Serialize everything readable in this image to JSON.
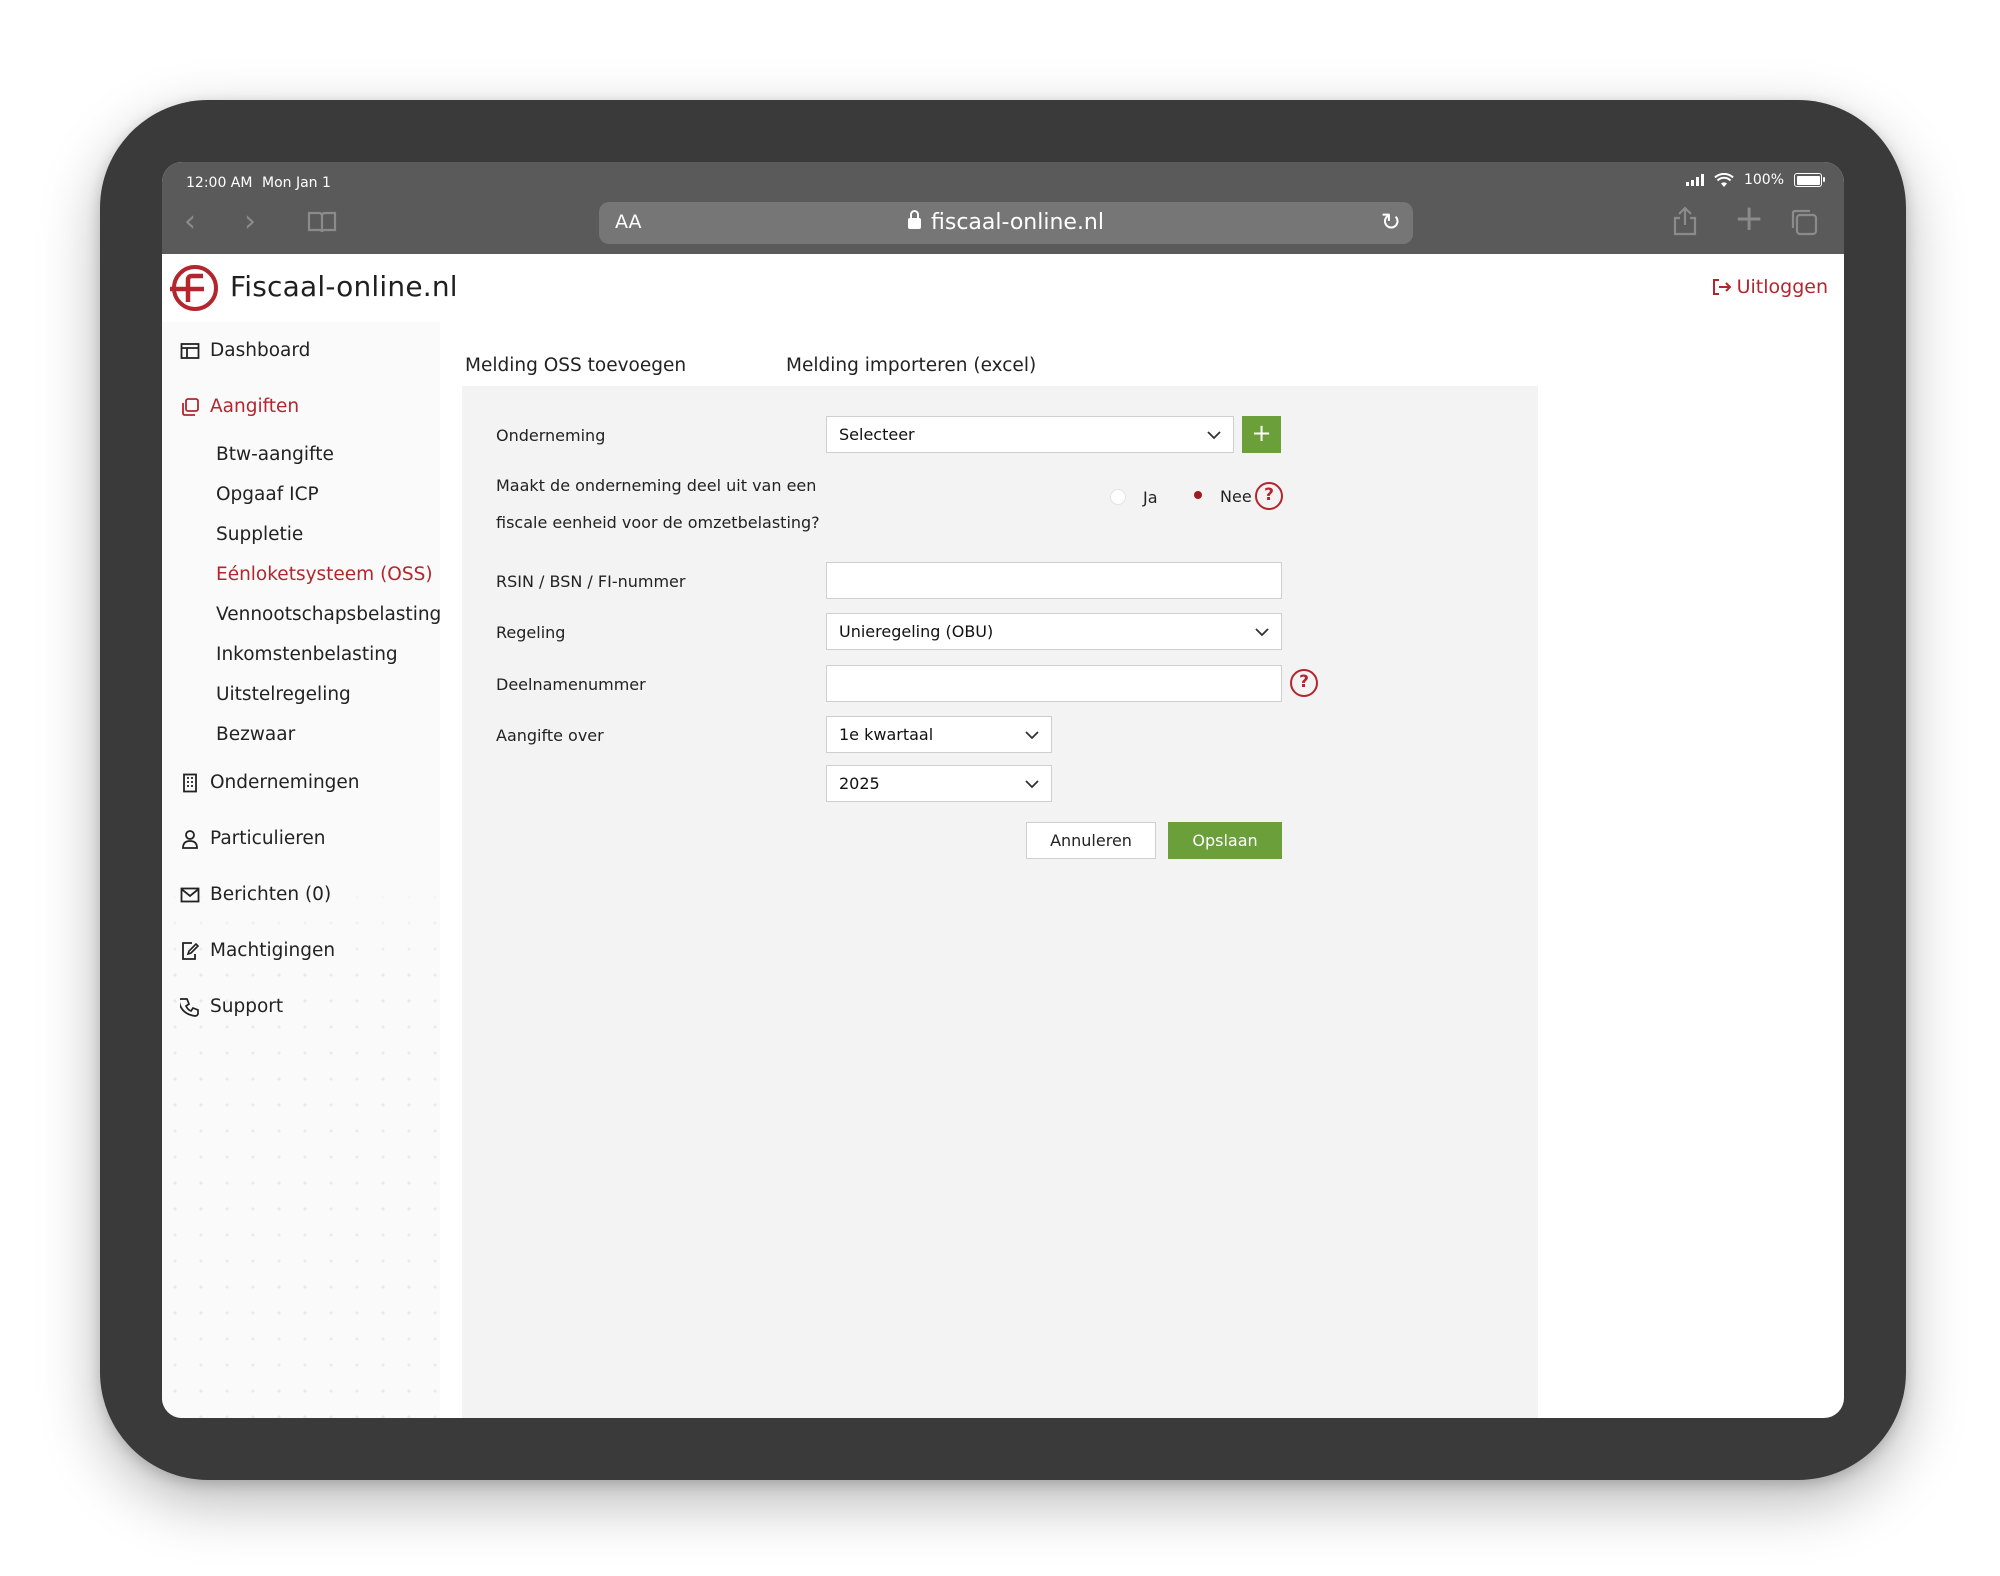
{
  "status_bar": {
    "time": "12:00 AM",
    "date": "Mon Jan 1",
    "battery": "100%"
  },
  "browser": {
    "text_size": "AA",
    "url": "fiscaal-online.nl"
  },
  "brand": {
    "name": "Fiscaal-online.nl",
    "color": "#b3262d"
  },
  "header": {
    "logout_label": "Uitloggen"
  },
  "sidebar": {
    "dashboard": "Dashboard",
    "aangiften": "Aangiften",
    "sub_items": [
      "Btw-aangifte",
      "Opgaaf ICP",
      "Suppletie",
      "Eénloketsysteem (OSS)",
      "Vennootschapsbelasting",
      "Inkomstenbelasting",
      "Uitstelregeling",
      "Bezwaar"
    ],
    "ondernemingen": "Ondernemingen",
    "particulieren": "Particulieren",
    "berichten": "Berichten (0)",
    "machtigingen": "Machtigingen",
    "support": "Support"
  },
  "tabs": [
    "Melding OSS toevoegen",
    "Melding importeren (excel)"
  ],
  "form": {
    "onderneming_label": "Onderneming",
    "onderneming_value": "Selecteer",
    "fiscale_question_line1": "Maakt de onderneming deel uit van een",
    "fiscale_question_line2": "fiscale eenheid voor de omzetbelasting?",
    "radio_ja": "Ja",
    "radio_nee": "Nee",
    "radio_selected": "Nee",
    "rsin_label": "RSIN / BSN / FI-nummer",
    "rsin_value": "",
    "regeling_label": "Regeling",
    "regeling_value": "Unieregeling (OBU)",
    "deelname_label": "Deelnamenummer",
    "deelname_value": "",
    "aangifte_label": "Aangifte over",
    "period_value": "1e kwartaal",
    "year_value": "2025",
    "help_glyph": "?",
    "plus_glyph": "+"
  },
  "buttons": {
    "cancel": "Annuleren",
    "save": "Opslaan"
  },
  "colors": {
    "accent_green": "#6a9f3a",
    "accent_red": "#b3262d"
  }
}
